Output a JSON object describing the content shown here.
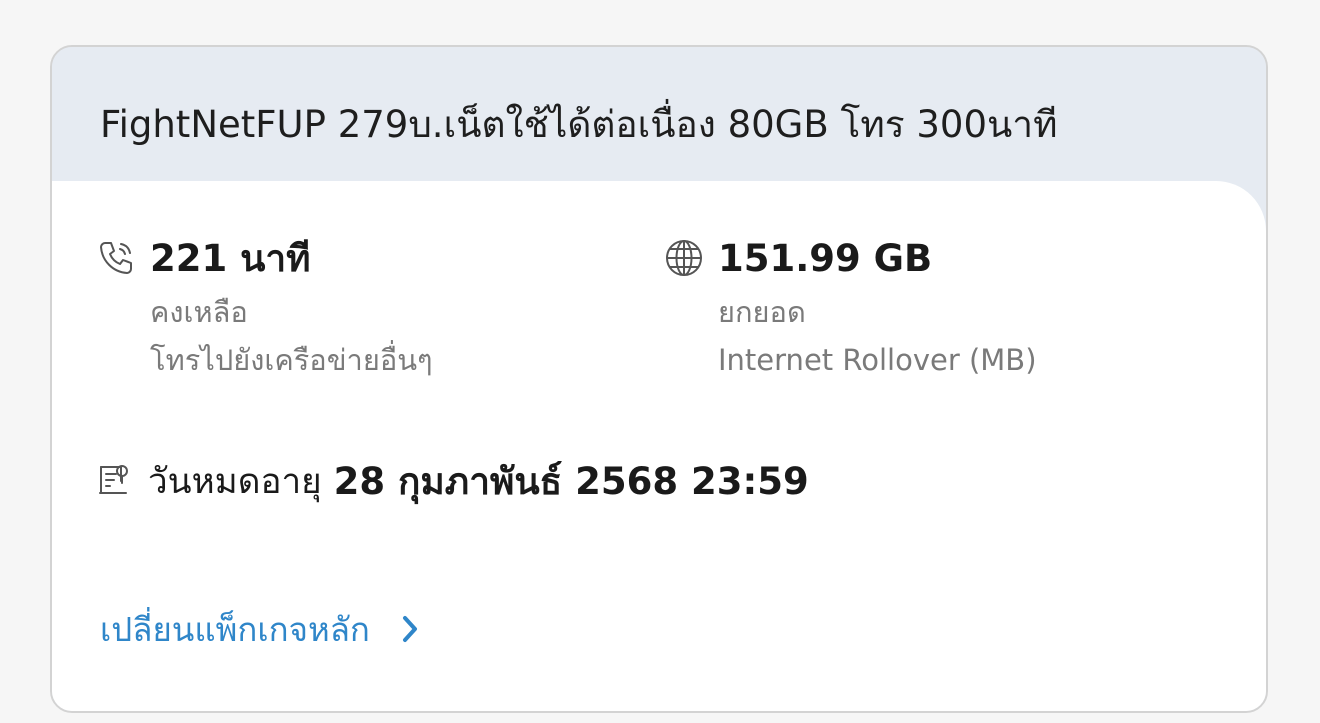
{
  "package": {
    "title": "FightNetFUP 279บ.เน็ตใช้ได้ต่อเนื่อง 80GB โทร 300นาที"
  },
  "voice": {
    "icon": "phone-icon",
    "value": "221 นาที",
    "line1": "คงเหลือ",
    "line2": "โทรไปยังเครือข่ายอื่นๆ"
  },
  "data": {
    "icon": "globe-icon",
    "value": "151.99 GB",
    "line1": "ยกยอด",
    "line2": "Internet Rollover (MB)"
  },
  "expiry": {
    "icon": "calendar-expiry-icon",
    "label": "วันหมดอายุ",
    "date": "28 กุมภาพันธ์ 2568 23:59"
  },
  "actions": {
    "change_main_package": "เปลี่ยนแพ็กเกจหลัก"
  },
  "colors": {
    "header_bg": "#e6ebf2",
    "link": "#2f86c9",
    "secondary_text": "#7a7a7a"
  }
}
